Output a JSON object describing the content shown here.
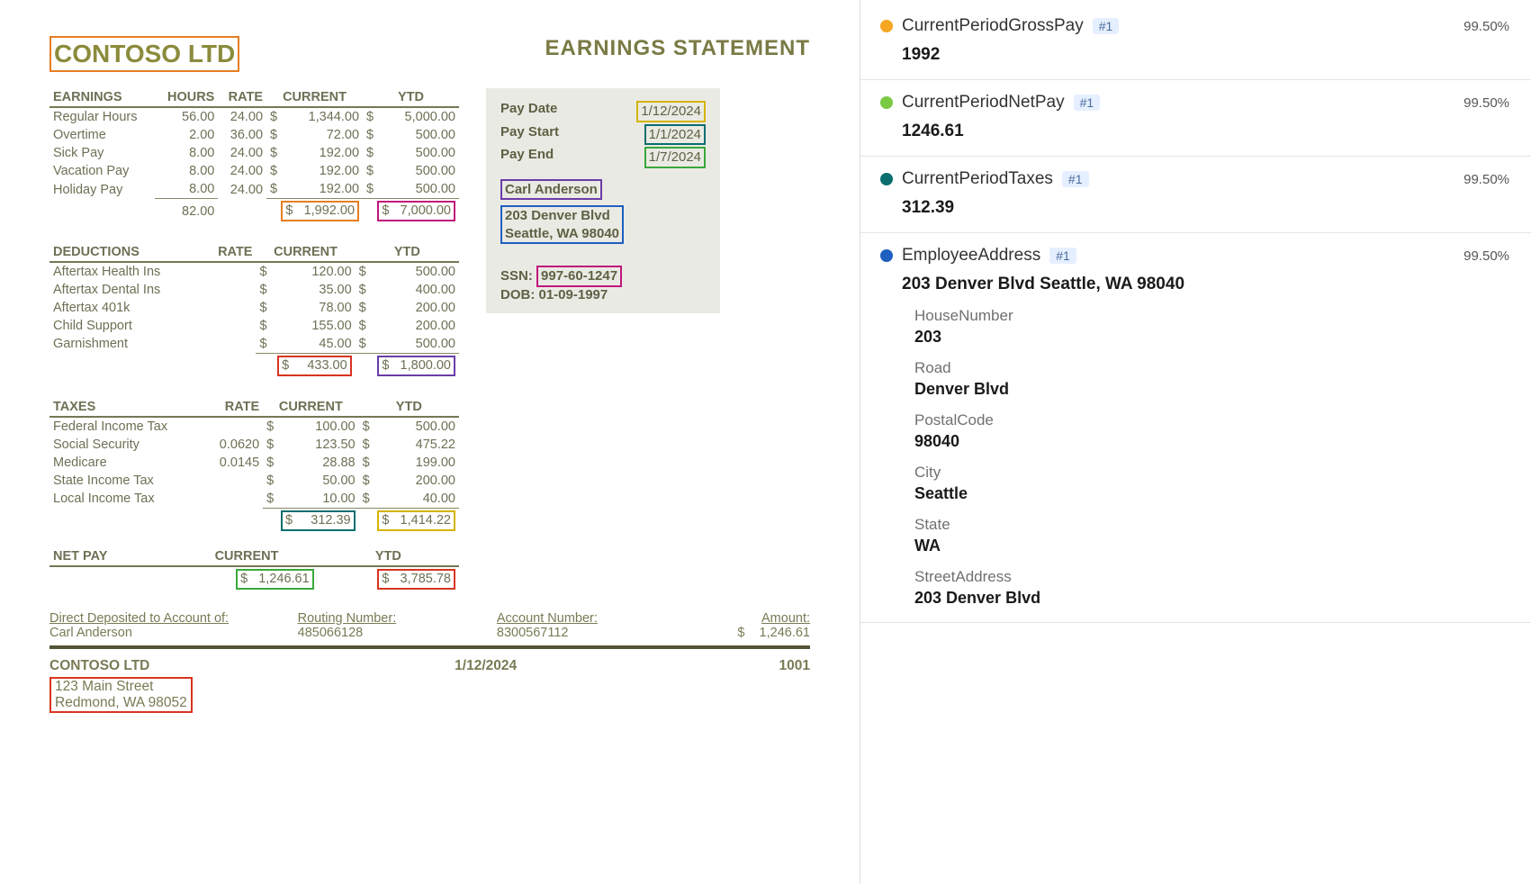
{
  "document": {
    "company": "CONTOSO LTD",
    "statement_title": "EARNINGS STATEMENT",
    "earnings": {
      "section": "EARNINGS",
      "headers": {
        "hours": "HOURS",
        "rate": "RATE",
        "current": "CURRENT",
        "ytd": "YTD"
      },
      "rows": [
        {
          "label": "Regular Hours",
          "hours": "56.00",
          "rate": "24.00",
          "cur": "1,344.00",
          "ytd": "5,000.00"
        },
        {
          "label": "Overtime",
          "hours": "2.00",
          "rate": "36.00",
          "cur": "72.00",
          "ytd": "500.00"
        },
        {
          "label": "Sick Pay",
          "hours": "8.00",
          "rate": "24.00",
          "cur": "192.00",
          "ytd": "500.00"
        },
        {
          "label": "Vacation Pay",
          "hours": "8.00",
          "rate": "24.00",
          "cur": "192.00",
          "ytd": "500.00"
        },
        {
          "label": "Holiday Pay",
          "hours": "8.00",
          "rate": "24.00",
          "cur": "192.00",
          "ytd": "500.00"
        }
      ],
      "totals": {
        "hours": "82.00",
        "cur": "1,992.00",
        "ytd": "7,000.00"
      }
    },
    "deductions": {
      "section": "DEDUCTIONS",
      "headers": {
        "rate": "RATE",
        "current": "CURRENT",
        "ytd": "YTD"
      },
      "rows": [
        {
          "label": "Aftertax Health Ins",
          "cur": "120.00",
          "ytd": "500.00"
        },
        {
          "label": "Aftertax Dental Ins",
          "cur": "35.00",
          "ytd": "400.00"
        },
        {
          "label": "Aftertax 401k",
          "cur": "78.00",
          "ytd": "200.00"
        },
        {
          "label": "Child Support",
          "cur": "155.00",
          "ytd": "200.00"
        },
        {
          "label": "Garnishment",
          "cur": "45.00",
          "ytd": "500.00"
        }
      ],
      "totals": {
        "cur": "433.00",
        "ytd": "1,800.00"
      }
    },
    "taxes": {
      "section": "TAXES",
      "headers": {
        "rate": "RATE",
        "current": "CURRENT",
        "ytd": "YTD"
      },
      "rows": [
        {
          "label": "Federal Income Tax",
          "rate": "",
          "cur": "100.00",
          "ytd": "500.00"
        },
        {
          "label": "Social Security",
          "rate": "0.0620",
          "cur": "123.50",
          "ytd": "475.22"
        },
        {
          "label": "Medicare",
          "rate": "0.0145",
          "cur": "28.88",
          "ytd": "199.00"
        },
        {
          "label": "State Income Tax",
          "rate": "",
          "cur": "50.00",
          "ytd": "200.00"
        },
        {
          "label": "Local Income Tax",
          "rate": "",
          "cur": "10.00",
          "ytd": "40.00"
        }
      ],
      "totals": {
        "cur": "312.39",
        "ytd": "1,414.22"
      }
    },
    "netpay": {
      "section": "NET PAY",
      "headers": {
        "current": "CURRENT",
        "ytd": "YTD"
      },
      "cur": "1,246.61",
      "ytd": "3,785.78"
    },
    "info": {
      "pay_date_lbl": "Pay Date",
      "pay_date": "1/12/2024",
      "pay_start_lbl": "Pay Start",
      "pay_start": "1/1/2024",
      "pay_end_lbl": "Pay End",
      "pay_end": "1/7/2024",
      "name": "Carl Anderson",
      "addr_line1": "203 Denver Blvd",
      "addr_line2": "Seattle, WA 98040",
      "ssn_lbl": "SSN:",
      "ssn": "997-60-1247",
      "dob": "DOB: 01-09-1997"
    },
    "bank": {
      "deposit_lbl": "Direct Deposited to Account of:",
      "deposit_name": "Carl Anderson",
      "routing_lbl": "Routing Number:",
      "routing": "485066128",
      "account_lbl": "Account Number:",
      "account": "8300567112",
      "amount_lbl": "Amount:",
      "amount": "1,246.61"
    },
    "footer": {
      "company": "CONTOSO LTD",
      "addr_line1": "123 Main Street",
      "addr_line2": "Redmond, WA 98052",
      "date": "1/12/2024",
      "number": "1001"
    },
    "dollar": "$"
  },
  "panel": {
    "fields": [
      {
        "color": "#f5a623",
        "name": "CurrentPeriodGrossPay",
        "badge": "#1",
        "conf": "99.50%",
        "value": "1992"
      },
      {
        "color": "#7ac943",
        "name": "CurrentPeriodNetPay",
        "badge": "#1",
        "conf": "99.50%",
        "value": "1246.61"
      },
      {
        "color": "#0a6e6e",
        "name": "CurrentPeriodTaxes",
        "badge": "#1",
        "conf": "99.50%",
        "value": "312.39"
      },
      {
        "color": "#1f5fbf",
        "name": "EmployeeAddress",
        "badge": "#1",
        "conf": "99.50%",
        "value": "203 Denver Blvd Seattle, WA 98040",
        "sub": [
          {
            "label": "HouseNumber",
            "value": "203"
          },
          {
            "label": "Road",
            "value": "Denver Blvd"
          },
          {
            "label": "PostalCode",
            "value": "98040"
          },
          {
            "label": "City",
            "value": "Seattle"
          },
          {
            "label": "State",
            "value": "WA"
          },
          {
            "label": "StreetAddress",
            "value": "203 Denver Blvd"
          }
        ]
      }
    ]
  }
}
